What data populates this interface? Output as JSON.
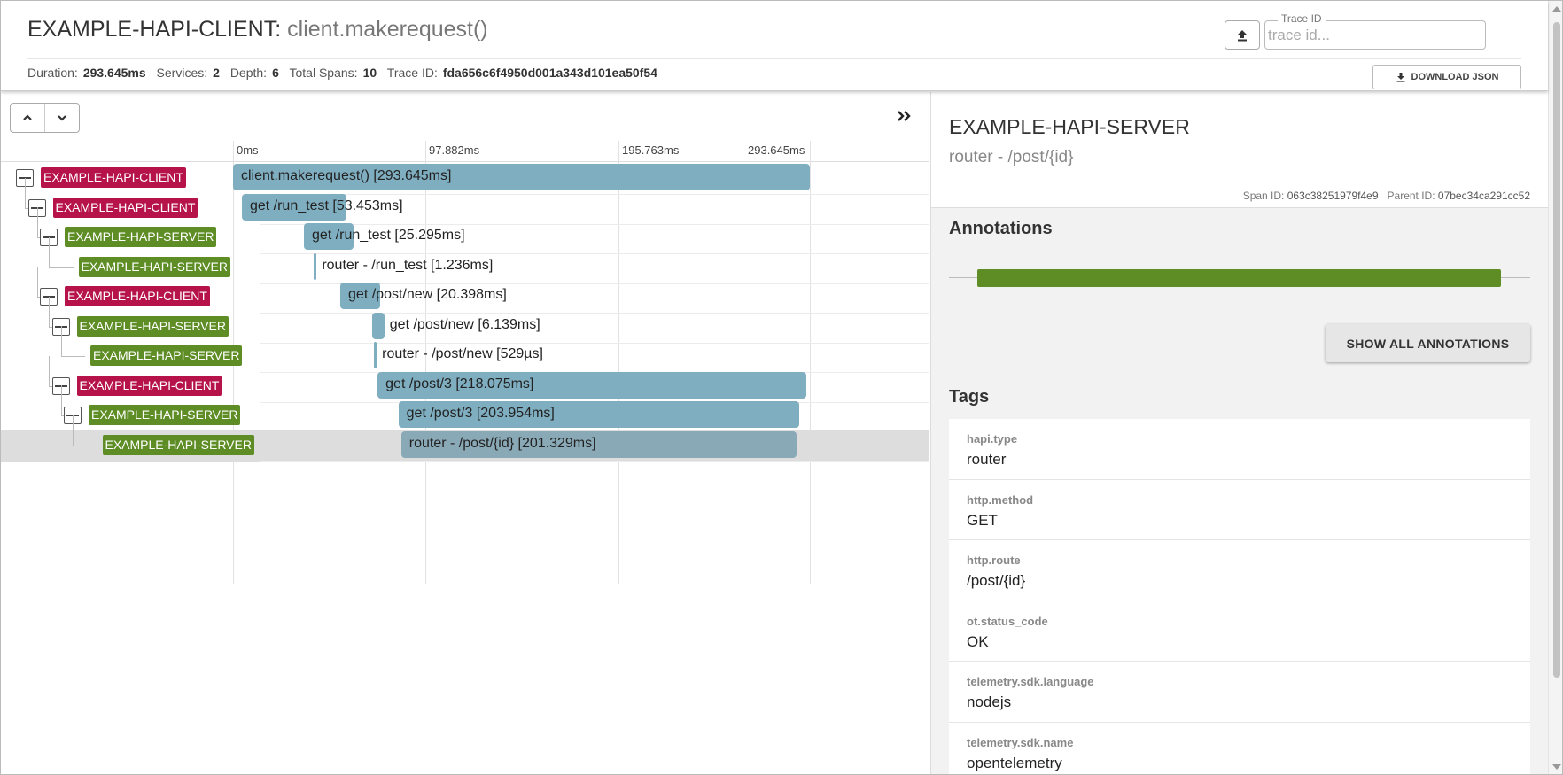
{
  "header": {
    "service": "EXAMPLE-HAPI-CLIENT",
    "separator": ":",
    "operation": "client.makerequest()",
    "summary": {
      "duration_label": "Duration:",
      "duration": "293.645ms",
      "services_label": "Services:",
      "services": "2",
      "depth_label": "Depth:",
      "depth": "6",
      "spans_label": "Total Spans:",
      "spans": "10",
      "traceid_label": "Trace ID:",
      "traceid": "fda656c6f4950d001a343d101ea50f54"
    },
    "trace_search": {
      "label": "Trace ID",
      "placeholder": "trace id..."
    },
    "download_label": "DOWNLOAD JSON"
  },
  "timeline": {
    "ticks": [
      "0ms",
      "97.882ms",
      "195.763ms",
      "293.645ms"
    ],
    "spans": [
      {
        "service": "EXAMPLE-HAPI-CLIENT",
        "kind": "client",
        "depth": 0,
        "toggle": true,
        "label": "client.makerequest() [293.645ms]",
        "start_ms": 0,
        "duration_ms": 293.645
      },
      {
        "service": "EXAMPLE-HAPI-CLIENT",
        "kind": "client",
        "depth": 1,
        "toggle": true,
        "label": "get /run_test [53.453ms]",
        "start_ms": 4.5,
        "duration_ms": 53.453
      },
      {
        "service": "EXAMPLE-HAPI-SERVER",
        "kind": "server",
        "depth": 2,
        "toggle": true,
        "label": "get /run_test [25.295ms]",
        "start_ms": 36.1,
        "duration_ms": 25.295
      },
      {
        "service": "EXAMPLE-HAPI-SERVER",
        "kind": "server",
        "depth": 3,
        "toggle": false,
        "label": "router - /run_test [1.236ms]",
        "start_ms": 41.2,
        "duration_ms": 1.236
      },
      {
        "service": "EXAMPLE-HAPI-CLIENT",
        "kind": "client",
        "depth": 2,
        "toggle": true,
        "label": "get /post/new [20.398ms]",
        "start_ms": 54.6,
        "duration_ms": 20.398
      },
      {
        "service": "EXAMPLE-HAPI-SERVER",
        "kind": "server",
        "depth": 3,
        "toggle": true,
        "label": "get /post/new [6.139ms]",
        "start_ms": 70.9,
        "duration_ms": 6.139
      },
      {
        "service": "EXAMPLE-HAPI-SERVER",
        "kind": "server",
        "depth": 4,
        "toggle": false,
        "label": "router - /post/new [529µs]",
        "start_ms": 71.8,
        "duration_ms": 0.529
      },
      {
        "service": "EXAMPLE-HAPI-CLIENT",
        "kind": "client",
        "depth": 3,
        "toggle": true,
        "label": "get /post/3 [218.075ms]",
        "start_ms": 73.6,
        "duration_ms": 218.075
      },
      {
        "service": "EXAMPLE-HAPI-SERVER",
        "kind": "server",
        "depth": 4,
        "toggle": true,
        "label": "get /post/3 [203.954ms]",
        "start_ms": 84.2,
        "duration_ms": 203.954
      },
      {
        "service": "EXAMPLE-HAPI-SERVER",
        "kind": "server",
        "depth": 5,
        "toggle": false,
        "label": "router - /post/{id} [201.329ms]",
        "start_ms": 85.6,
        "duration_ms": 201.329,
        "selected": true
      }
    ]
  },
  "detail": {
    "service": "EXAMPLE-HAPI-SERVER",
    "operation": "router - /post/{id}",
    "span_id_label": "Span ID:",
    "span_id": "063c38251979f4e9",
    "parent_id_label": "Parent ID:",
    "parent_id": "07bec34ca291cc52",
    "annotations_heading": "Annotations",
    "show_annotations_label": "SHOW ALL ANNOTATIONS",
    "tags_heading": "Tags",
    "tags": [
      {
        "key": "hapi.type",
        "value": "router"
      },
      {
        "key": "http.method",
        "value": "GET"
      },
      {
        "key": "http.route",
        "value": "/post/{id}"
      },
      {
        "key": "ot.status_code",
        "value": "OK"
      },
      {
        "key": "telemetry.sdk.language",
        "value": "nodejs"
      },
      {
        "key": "telemetry.sdk.name",
        "value": "opentelemetry"
      }
    ]
  },
  "colors": {
    "client": "#b5134a",
    "server": "#5e8c25",
    "bar": "#7faec0",
    "selected_bar": "#8aa9b6"
  },
  "icons": [
    "upload-icon",
    "download-icon",
    "chevron-up-icon",
    "chevron-down-icon",
    "double-chevron-right-icon",
    "collapse-toggle-icon"
  ]
}
